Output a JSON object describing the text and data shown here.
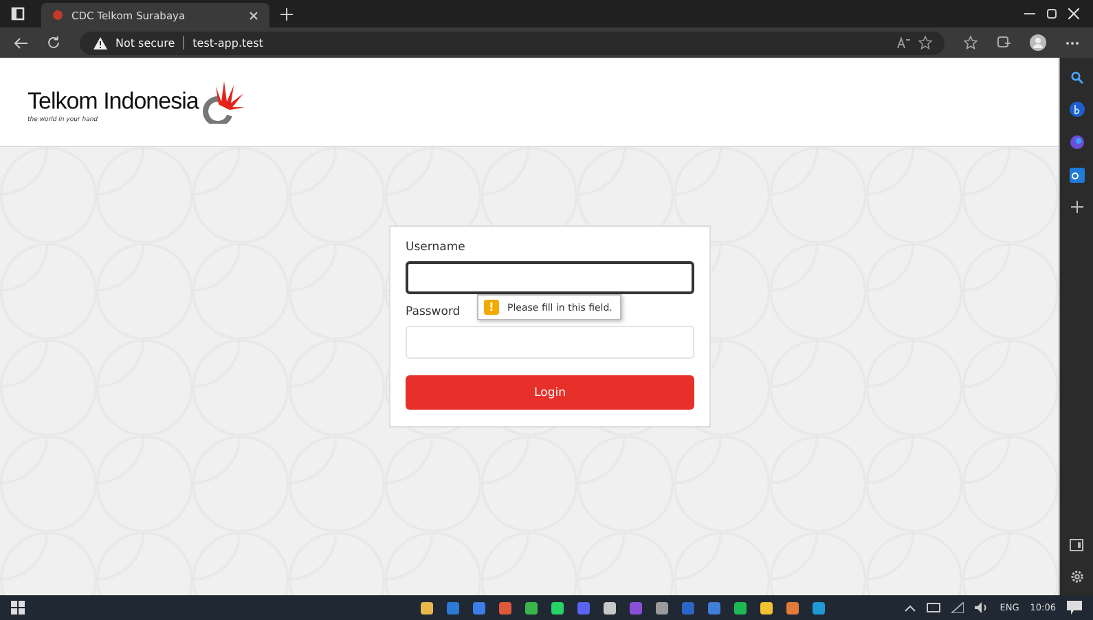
{
  "browser": {
    "tab": {
      "title": "CDC Telkom Surabaya",
      "selected": true
    },
    "address": {
      "security": "Not secure",
      "url": "test-app.test"
    }
  },
  "header": {
    "brand": "Telkom Indonesia",
    "tagline": "the world in your hand"
  },
  "login_form": {
    "fields": [
      {
        "label": "Username",
        "focused": true
      },
      {
        "label": "Password",
        "focused": false
      }
    ],
    "tooltip": {
      "mark": "!",
      "text": "Please fill in this field."
    },
    "button": "Login"
  },
  "taskbar": {
    "apps": [
      {
        "color": "#e8b94a"
      },
      {
        "color": "#2a7bd6"
      },
      {
        "color": "#3b7ee8"
      },
      {
        "color": "#e0583a"
      },
      {
        "color": "#3bb54a"
      },
      {
        "color": "#25d366"
      },
      {
        "color": "#5865f2"
      },
      {
        "color": "#c8c8c8"
      },
      {
        "color": "#8a4fd8"
      },
      {
        "color": "#9a9a9a"
      },
      {
        "color": "#2b66c7"
      },
      {
        "color": "#3f7fd9"
      },
      {
        "color": "#1db954"
      },
      {
        "color": "#f2c230"
      },
      {
        "color": "#e07b39"
      },
      {
        "color": "#1f9ad6"
      }
    ],
    "language": "ENG",
    "time": "10:06"
  }
}
